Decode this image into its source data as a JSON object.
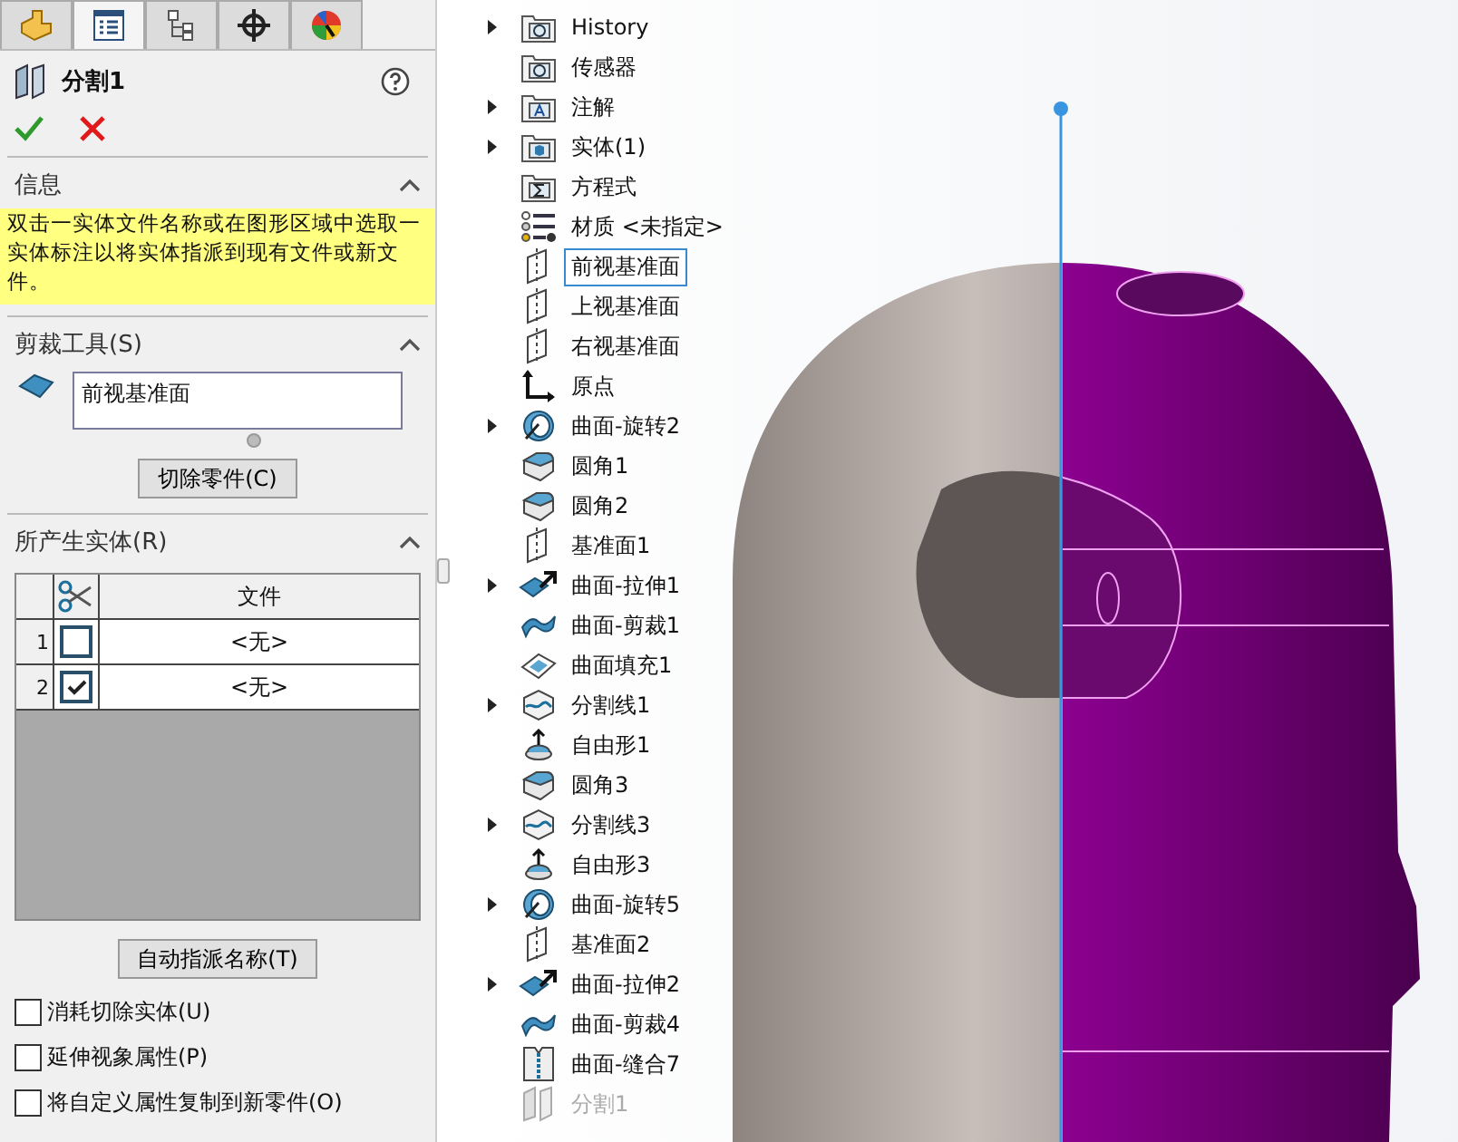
{
  "tabs": [
    {
      "selected": false
    },
    {
      "selected": true
    },
    {
      "selected": false
    },
    {
      "selected": false
    },
    {
      "selected": false
    }
  ],
  "feature_title": "分割1",
  "info": {
    "title": "信息",
    "text": "双击一实体文件名称或在图形区域中选取一实体标注以将实体指派到现有文件或新文件。"
  },
  "trim_tools": {
    "title": "剪裁工具(S)",
    "selection": "前视基准面",
    "button": "切除零件(C)"
  },
  "bodies": {
    "title": "所产生实体(R)",
    "file_column": "文件",
    "rows": [
      {
        "number": "1",
        "checked": false,
        "file": "<无>"
      },
      {
        "number": "2",
        "checked": true,
        "file": "<无>"
      }
    ],
    "button": "自动指派名称(T)"
  },
  "options": [
    {
      "label": "消耗切除实体(U)",
      "checked": false
    },
    {
      "label": "延伸视象属性(P)",
      "checked": false
    },
    {
      "label": "将自定义属性复制到新零件(O)",
      "checked": false
    }
  ],
  "tree": [
    {
      "label": "History",
      "kind": "folder-history",
      "expandable": true,
      "selected": false,
      "disabled": false
    },
    {
      "label": "传感器",
      "kind": "folder-sensor",
      "expandable": false,
      "selected": false,
      "disabled": false
    },
    {
      "label": "注解",
      "kind": "folder-note",
      "expandable": true,
      "selected": false,
      "disabled": false
    },
    {
      "label": "实体(1)",
      "kind": "folder-body",
      "expandable": true,
      "selected": false,
      "disabled": false
    },
    {
      "label": "方程式",
      "kind": "folder-sum",
      "expandable": false,
      "selected": false,
      "disabled": false
    },
    {
      "label": "材质 <未指定>",
      "kind": "material",
      "expandable": false,
      "selected": false,
      "disabled": false
    },
    {
      "label": "前视基准面",
      "kind": "plane",
      "expandable": false,
      "selected": true,
      "disabled": false
    },
    {
      "label": "上视基准面",
      "kind": "plane",
      "expandable": false,
      "selected": false,
      "disabled": false
    },
    {
      "label": "右视基准面",
      "kind": "plane",
      "expandable": false,
      "selected": false,
      "disabled": false
    },
    {
      "label": "原点",
      "kind": "origin",
      "expandable": false,
      "selected": false,
      "disabled": false
    },
    {
      "label": "曲面-旋转2",
      "kind": "revolve",
      "expandable": true,
      "selected": false,
      "disabled": false
    },
    {
      "label": "圆角1",
      "kind": "fillet",
      "expandable": false,
      "selected": false,
      "disabled": false
    },
    {
      "label": "圆角2",
      "kind": "fillet",
      "expandable": false,
      "selected": false,
      "disabled": false
    },
    {
      "label": "基准面1",
      "kind": "plane",
      "expandable": false,
      "selected": false,
      "disabled": false
    },
    {
      "label": "曲面-拉伸1",
      "kind": "extrude",
      "expandable": true,
      "selected": false,
      "disabled": false
    },
    {
      "label": "曲面-剪裁1",
      "kind": "trim",
      "expandable": false,
      "selected": false,
      "disabled": false
    },
    {
      "label": "曲面填充1",
      "kind": "fill",
      "expandable": false,
      "selected": false,
      "disabled": false
    },
    {
      "label": "分割线1",
      "kind": "splitline",
      "expandable": true,
      "selected": false,
      "disabled": false
    },
    {
      "label": "自由形1",
      "kind": "freeform",
      "expandable": false,
      "selected": false,
      "disabled": false
    },
    {
      "label": "圆角3",
      "kind": "fillet",
      "expandable": false,
      "selected": false,
      "disabled": false
    },
    {
      "label": "分割线3",
      "kind": "splitline",
      "expandable": true,
      "selected": false,
      "disabled": false
    },
    {
      "label": "自由形3",
      "kind": "freeform",
      "expandable": false,
      "selected": false,
      "disabled": false
    },
    {
      "label": "曲面-旋转5",
      "kind": "revolve",
      "expandable": true,
      "selected": false,
      "disabled": false
    },
    {
      "label": "基准面2",
      "kind": "plane",
      "expandable": false,
      "selected": false,
      "disabled": false
    },
    {
      "label": "曲面-拉伸2",
      "kind": "extrude",
      "expandable": true,
      "selected": false,
      "disabled": false
    },
    {
      "label": "曲面-剪裁4",
      "kind": "trim",
      "expandable": false,
      "selected": false,
      "disabled": false
    },
    {
      "label": "曲面-缝合7",
      "kind": "knit",
      "expandable": false,
      "selected": false,
      "disabled": false
    },
    {
      "label": "分割1",
      "kind": "split",
      "expandable": false,
      "selected": false,
      "disabled": true
    }
  ]
}
